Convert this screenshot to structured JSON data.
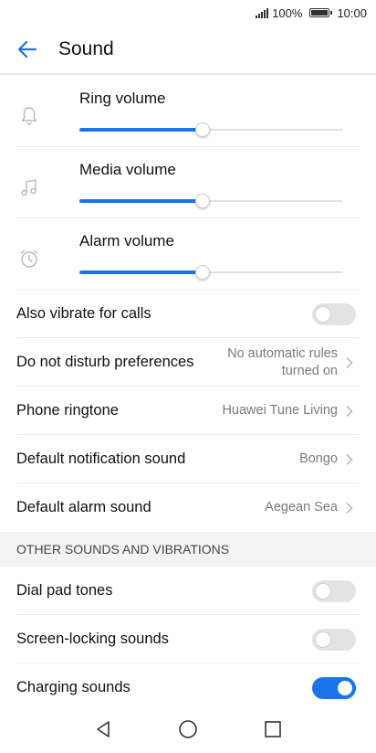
{
  "status_bar": {
    "battery_text": "100%",
    "time": "10:00"
  },
  "app_bar": {
    "title": "Sound",
    "back_icon": "arrow-left-icon",
    "accent": "#1a73e8"
  },
  "volumes": [
    {
      "label": "Ring volume",
      "icon": "bell-icon",
      "level": 0.47
    },
    {
      "label": "Media volume",
      "icon": "music-note-icon",
      "level": 0.47
    },
    {
      "label": "Alarm volume",
      "icon": "alarm-clock-icon",
      "level": 0.47
    }
  ],
  "settings": {
    "vibrate": {
      "label": "Also vibrate for calls",
      "enabled": false
    },
    "dnd": {
      "label": "Do not disturb preferences",
      "value_line1": "No automatic rules",
      "value_line2": "turned on"
    },
    "ringtone": {
      "label": "Phone ringtone",
      "value": "Huawei Tune Living"
    },
    "notification": {
      "label": "Default notification sound",
      "value": "Bongo"
    },
    "alarm": {
      "label": "Default alarm sound",
      "value": "Aegean Sea"
    }
  },
  "other_section": {
    "header": "OTHER SOUNDS AND VIBRATIONS",
    "dial_pad": {
      "label": "Dial pad tones",
      "enabled": false
    },
    "screen_lock": {
      "label": "Screen-locking sounds",
      "enabled": false
    },
    "charging": {
      "label": "Charging sounds",
      "enabled": true
    }
  },
  "nav_bar": {
    "back": "triangle-back-icon",
    "home": "circle-home-icon",
    "recents": "square-recents-icon"
  }
}
